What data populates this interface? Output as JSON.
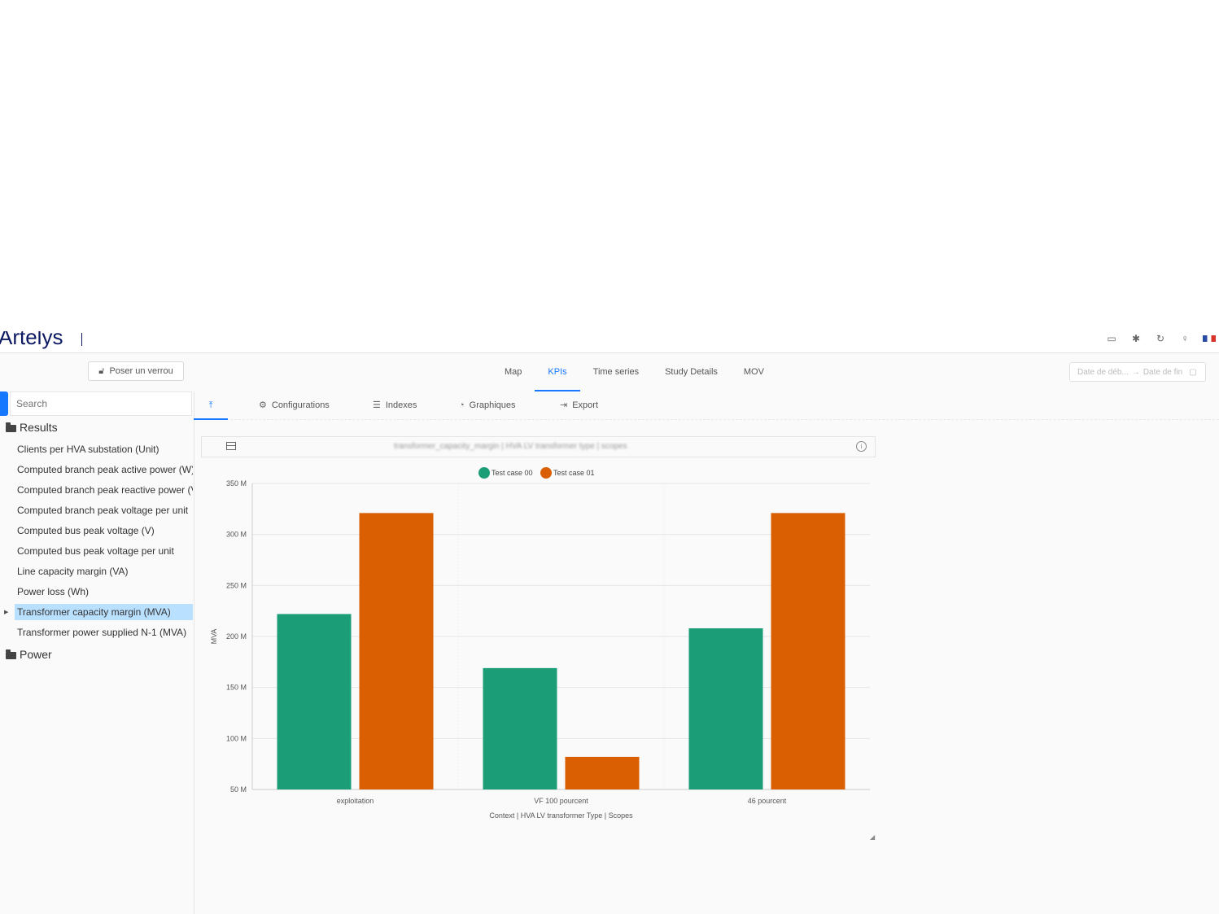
{
  "app": {
    "logo_text": "Artelys"
  },
  "header": {
    "lock_button_label": "Poser un verrou",
    "date_start_placeholder": "Date de déb...",
    "date_arrow": "→",
    "date_end_placeholder": "Date de fin"
  },
  "main_tabs": [
    {
      "label": "Map",
      "active": false
    },
    {
      "label": "KPIs",
      "active": true
    },
    {
      "label": "Time series",
      "active": false
    },
    {
      "label": "Study Details",
      "active": false
    },
    {
      "label": "MOV",
      "active": false
    }
  ],
  "sidebar": {
    "search_placeholder": "Search",
    "folders": [
      {
        "label": "Results"
      },
      {
        "label": "Power"
      }
    ],
    "items": [
      {
        "label": "Clients per HVA substation (Unit)"
      },
      {
        "label": "Computed branch peak active power (W)"
      },
      {
        "label": "Computed branch peak reactive power (VAr)"
      },
      {
        "label": "Computed branch peak voltage per unit"
      },
      {
        "label": "Computed bus peak voltage (V)"
      },
      {
        "label": "Computed bus peak voltage per unit"
      },
      {
        "label": "Line capacity margin (VA)"
      },
      {
        "label": "Power loss (Wh)"
      },
      {
        "label": "Transformer capacity margin (MVA)",
        "selected": true
      },
      {
        "label": "Transformer power supplied N-1 (MVA)"
      }
    ]
  },
  "content_tabs": [
    {
      "label": "",
      "icon": "upload-icon",
      "active": true
    },
    {
      "label": "Configurations",
      "icon": "gear-icon"
    },
    {
      "label": "Indexes",
      "icon": "list-icon"
    },
    {
      "label": "Graphiques",
      "icon": "pie-chart-icon"
    },
    {
      "label": "Export",
      "icon": "export-icon"
    }
  ],
  "chart_header": {
    "title": "transformer_capacity_margin | HVA LV transformer type | scopes"
  },
  "chart_data": {
    "type": "bar",
    "title": "",
    "xlabel": "Context | HVA LV transformer Type | Scopes",
    "ylabel": "MVA",
    "categories": [
      "exploitation",
      "VF 100 pourcent",
      "46 pourcent"
    ],
    "series": [
      {
        "name": "Test case 00",
        "color": "#1b9e77",
        "values": [
          222,
          169,
          208
        ]
      },
      {
        "name": "Test case 01",
        "color": "#d95f02",
        "values": [
          321,
          82,
          321
        ]
      }
    ],
    "ylim": [
      50,
      350
    ],
    "yticks": [
      50,
      100,
      150,
      200,
      250,
      300,
      350
    ],
    "ytick_labels": [
      "50 M",
      "100 M",
      "150 M",
      "200 M",
      "250 M",
      "300 M",
      "350 M"
    ],
    "legend_position": "top-center",
    "grid": true
  }
}
